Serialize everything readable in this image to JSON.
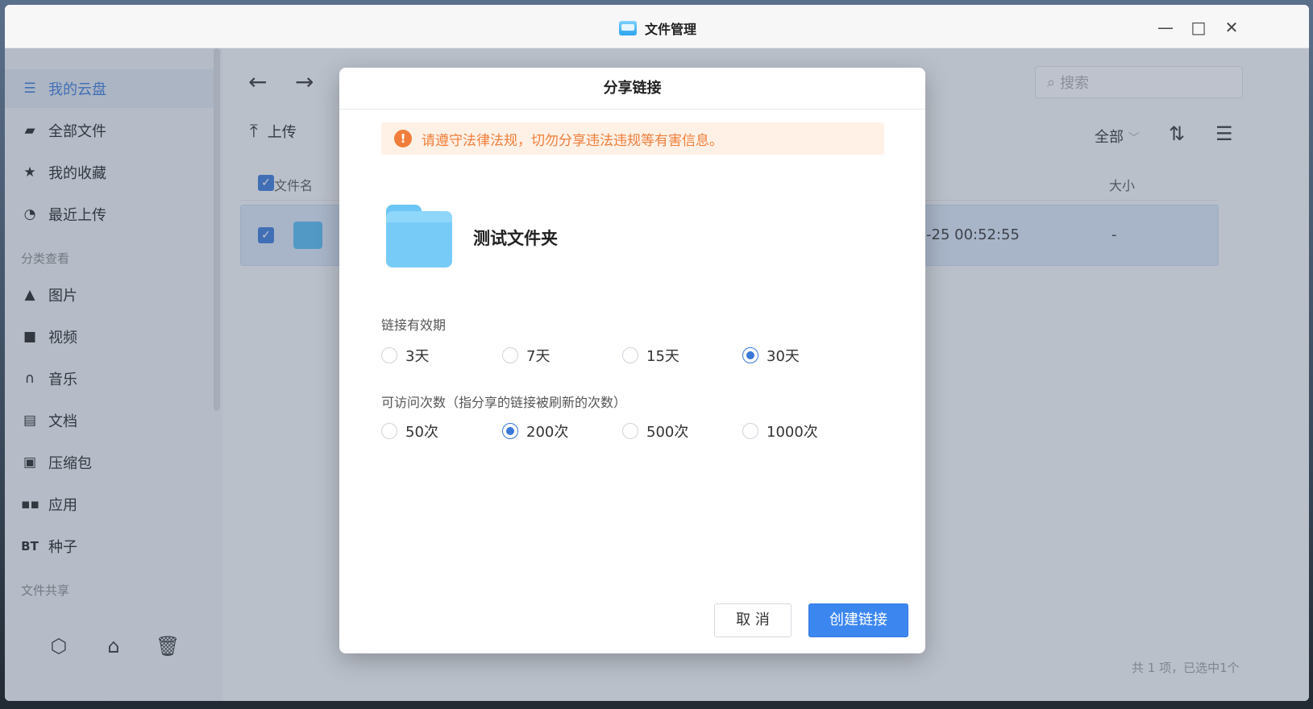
{
  "window": {
    "title": "文件管理",
    "controls": {
      "minimize": "—",
      "maximize": "□",
      "close": "✕"
    }
  },
  "sidebar": {
    "items": [
      {
        "label": "我的云盘",
        "icon": "stack-icon",
        "active": true
      },
      {
        "label": "全部文件",
        "icon": "folder-icon"
      },
      {
        "label": "我的收藏",
        "icon": "star-icon"
      },
      {
        "label": "最近上传",
        "icon": "clock-icon"
      }
    ],
    "group_category": "分类查看",
    "categories": [
      {
        "label": "图片",
        "icon": "image-icon"
      },
      {
        "label": "视频",
        "icon": "video-icon"
      },
      {
        "label": "音乐",
        "icon": "headphones-icon"
      },
      {
        "label": "文档",
        "icon": "document-icon"
      },
      {
        "label": "压缩包",
        "icon": "archive-icon"
      },
      {
        "label": "应用",
        "icon": "apps-icon"
      },
      {
        "label": "种子",
        "icon": "bt-icon",
        "prefix": "BT"
      }
    ],
    "group_share": "文件共享"
  },
  "toolbar": {
    "upload_label": "上传",
    "search_placeholder": "搜索",
    "filter_label": "全部"
  },
  "table": {
    "col_name": "文件名",
    "col_size": "大小",
    "row": {
      "date": "-25 00:52:55",
      "size": "-"
    }
  },
  "status": {
    "summary": "共 1 项，已选中1个"
  },
  "dialog": {
    "title": "分享链接",
    "warning": "请遵守法律法规，切勿分享违法违规等有害信息。",
    "folder_name": "测试文件夹",
    "validity_label": "链接有效期",
    "validity_options": [
      {
        "label": "3天",
        "checked": false
      },
      {
        "label": "7天",
        "checked": false
      },
      {
        "label": "15天",
        "checked": false
      },
      {
        "label": "30天",
        "checked": true
      }
    ],
    "visits_label": "可访问次数（指分享的链接被刷新的次数）",
    "visits_options": [
      {
        "label": "50次",
        "checked": false
      },
      {
        "label": "200次",
        "checked": true
      },
      {
        "label": "500次",
        "checked": false
      },
      {
        "label": "1000次",
        "checked": false
      }
    ],
    "cancel_label": "取 消",
    "create_label": "创建链接"
  }
}
